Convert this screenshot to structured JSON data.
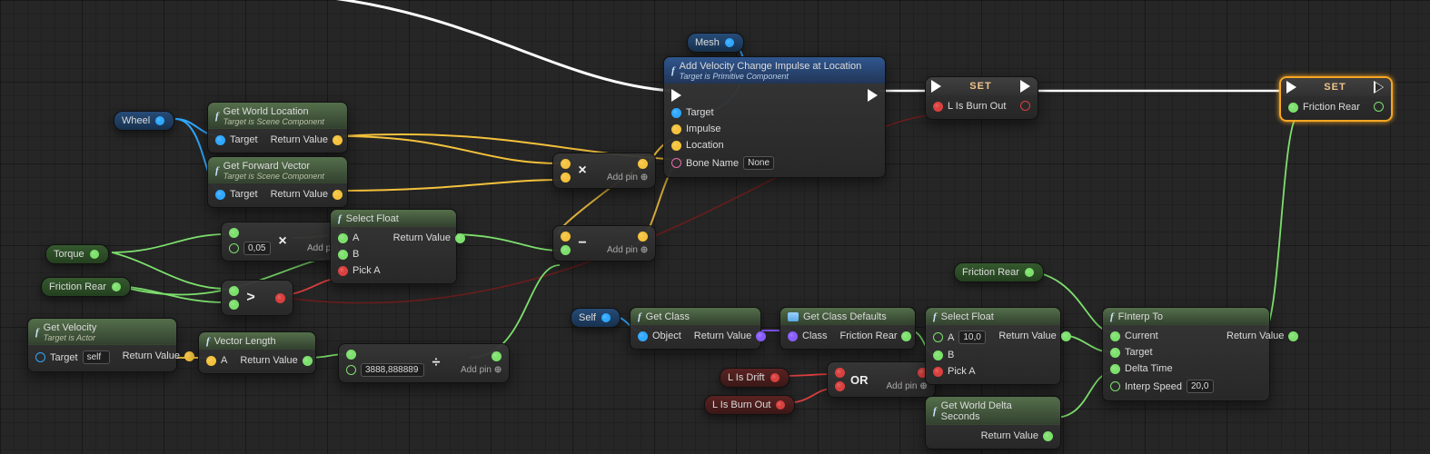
{
  "labels": {
    "add_pin": "Add pin",
    "f": "f"
  },
  "variables": {
    "self_tag": "Self",
    "mesh": "Mesh",
    "wheel": "Wheel",
    "torque": "Torque",
    "friction_rear": "Friction Rear",
    "l_is_drift": "L Is Drift",
    "l_is_burn_out": "L Is Burn Out"
  },
  "nodes": {
    "get_world_location": {
      "title": "Get World Location",
      "subtitle": "Target is Scene Component",
      "in": [
        "Target"
      ],
      "out": [
        "Return Value"
      ]
    },
    "get_forward_vector": {
      "title": "Get Forward Vector",
      "subtitle": "Target is Scene Component",
      "in": [
        "Target"
      ],
      "out": [
        "Return Value"
      ]
    },
    "get_velocity": {
      "title": "Get Velocity",
      "subtitle": "Target is Actor",
      "target_self": "self",
      "in": [
        "Target"
      ],
      "out": [
        "Return Value"
      ]
    },
    "vector_length": {
      "title": "Vector Length",
      "in": [
        "A"
      ],
      "out": [
        "Return Value"
      ]
    },
    "select_float_1": {
      "title": "Select Float",
      "in": [
        "A",
        "B",
        "Pick A"
      ],
      "out": [
        "Return Value"
      ]
    },
    "add_impulse": {
      "title": "Add Velocity Change Impulse at Location",
      "subtitle": "Target is Primitive Component",
      "in": [
        "Target",
        "Impulse",
        "Location",
        "Bone Name"
      ],
      "bone_name": "None"
    },
    "set_burnout": {
      "title": "SET",
      "pin": "L Is Burn Out"
    },
    "set_friction": {
      "title": "SET",
      "pin": "Friction Rear"
    },
    "get_class": {
      "title": "Get Class",
      "in": [
        "Object"
      ],
      "out": [
        "Return Value"
      ]
    },
    "get_class_defaults": {
      "title": "Get Class Defaults",
      "in": [
        "Class"
      ],
      "out": [
        "Friction Rear"
      ]
    },
    "select_float_2": {
      "title": "Select Float",
      "a_val": "10,0",
      "in": [
        "A",
        "B",
        "Pick A"
      ],
      "out": [
        "Return Value"
      ]
    },
    "get_delta": {
      "title": "Get World Delta Seconds",
      "out": [
        "Return Value"
      ]
    },
    "finterp": {
      "title": "FInterp To",
      "in": [
        "Current",
        "Target",
        "Delta Time",
        "Interp Speed"
      ],
      "out": [
        "Return Value"
      ],
      "interp_speed": "20,0"
    },
    "mul": {
      "op": "×",
      "val": "0,05"
    },
    "gt": {
      "op": ">"
    },
    "mul2": {
      "op": "×"
    },
    "sub": {
      "op": "−"
    },
    "div": {
      "op": "÷",
      "val": "3888,888889"
    },
    "or": {
      "op": "OR"
    }
  }
}
